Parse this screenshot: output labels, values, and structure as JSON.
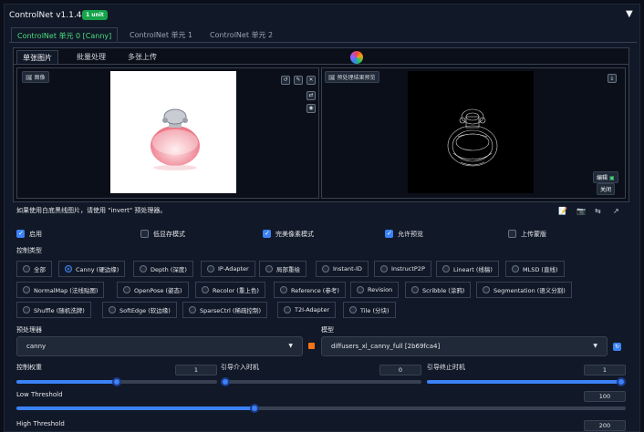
{
  "header": {
    "title": "ControlNet v1.1.445",
    "badge": "1 unit"
  },
  "unit_tabs": [
    "ControlNet 单元 0 [Canny]",
    "ControlNet 单元 1",
    "ControlNet 单元 2"
  ],
  "sub_tabs": [
    "单张图片",
    "批量处理",
    "多张上传"
  ],
  "image_panel": {
    "label": "图像"
  },
  "preview_panel": {
    "label": "预处理结果预览",
    "allow_btn": "编辑",
    "close_btn": "关闭"
  },
  "hint": "如果使用白底黑线图片，请使用 \"invert\" 预处理器。",
  "checkboxes": [
    {
      "label": "启用",
      "checked": true
    },
    {
      "label": "低显存模式",
      "checked": false
    },
    {
      "label": "完美像素模式",
      "checked": true
    },
    {
      "label": "允许预览",
      "checked": true
    },
    {
      "label": "上传蒙版",
      "checked": false
    }
  ],
  "control_type": {
    "label": "控制类型",
    "selected": "Canny (硬边缘)",
    "row1": [
      "全部",
      "Canny (硬边缘)",
      "Depth (深度)",
      "IP-Adapter",
      "局部重绘",
      "Instant-ID",
      "InstructP2P",
      "Lineart (线稿)",
      "MLSD (直线)"
    ],
    "row2": [
      "NormalMap (法线贴图)",
      "OpenPose (姿态)",
      "Recolor (重上色)",
      "Reference (参考)",
      "Revision",
      "Scribble (涂鸦)",
      "Segmentation (语义分割)"
    ],
    "row3": [
      "Shuffle (随机洗牌)",
      "SoftEdge (软边缘)",
      "SparseCtrl (稀疏控制)",
      "T2I-Adapter",
      "Tile (分块)"
    ]
  },
  "preprocessor": {
    "label": "预处理器",
    "value": "canny"
  },
  "model": {
    "label": "模型",
    "value": "diffusers_xl_canny_full [2b69fca4]"
  },
  "sliders": {
    "weight": {
      "label": "控制权重",
      "value": "1",
      "fraction": 0.5
    },
    "start": {
      "label": "引导介入时机",
      "value": "0",
      "fraction": 0.0
    },
    "end": {
      "label": "引导终止时机",
      "value": "1",
      "fraction": 1.0
    },
    "low": {
      "label": "Low Threshold",
      "value": "100",
      "fraction": 0.39
    },
    "high": {
      "label": "High Threshold",
      "value": "200"
    }
  },
  "colors": {
    "accent": "#3b82f6",
    "badge": "#16a34a",
    "active_tab": "#4ade80"
  }
}
